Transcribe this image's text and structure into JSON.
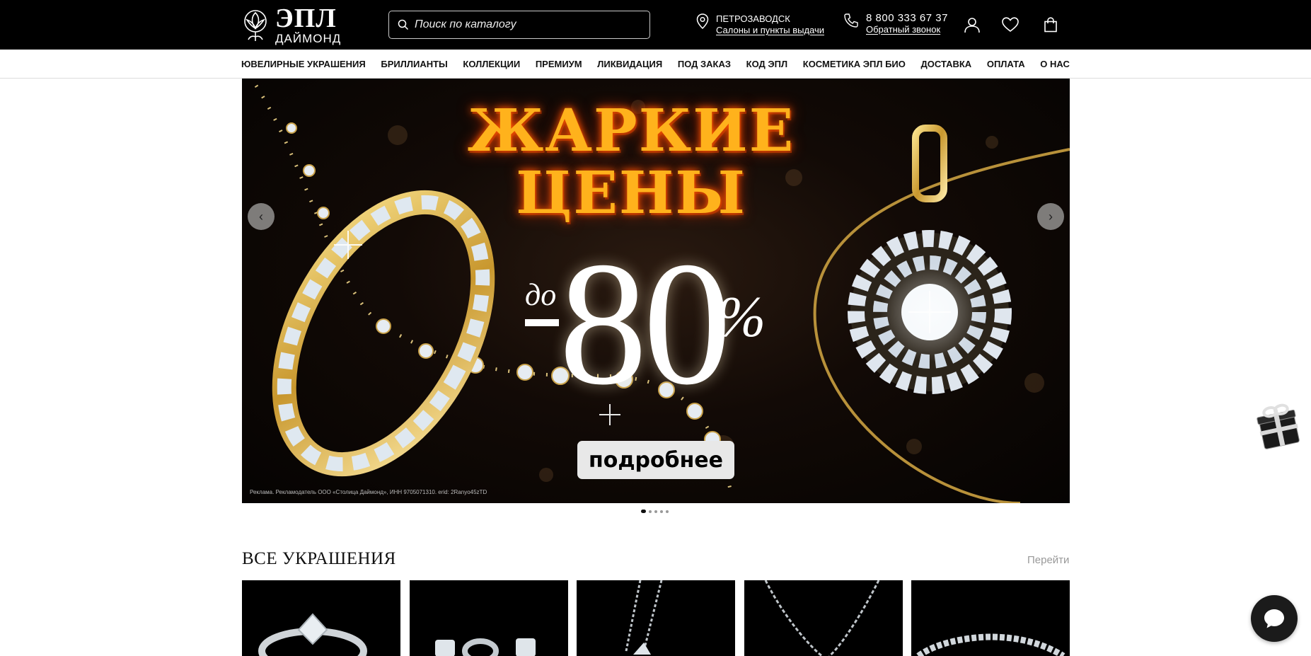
{
  "header": {
    "logo": {
      "main": "ЭПЛ",
      "sub": "ДАЙМОНД"
    },
    "search_placeholder": "Поиск по каталогу",
    "city": {
      "name": "ПЕТРОЗАВОДСК",
      "link": "Салоны и пункты выдачи"
    },
    "phone": {
      "number": "8 800 333 67 37",
      "link": "Обратный звонок"
    },
    "icons": [
      "location-icon",
      "phone-icon",
      "user-icon",
      "heart-icon",
      "bag-icon"
    ]
  },
  "nav": {
    "items": [
      "ЮВЕЛИРНЫЕ УКРАШЕНИЯ",
      "БРИЛЛИАНТЫ",
      "КОЛЛЕКЦИИ",
      "ПРЕМИУМ",
      "ЛИКВИДАЦИЯ",
      "ПОД ЗАКАЗ",
      "КОД ЭПЛ",
      "КОСМЕТИКА ЭПЛ БИО",
      "ДОСТАВКА",
      "ОПЛАТА",
      "О НАС"
    ]
  },
  "banner": {
    "title_line1": "ЖАРКИЕ",
    "title_line2": "ЦЕНЫ",
    "prefix": "до",
    "number": "80",
    "percent": "%",
    "button": "подробнее",
    "ad_note": "Реклама. Рекламодатель ООО «Столица Даймонд», ИНН 9705071310. erid: 2Ranyo45zTD",
    "prev_arrow": "‹",
    "next_arrow": "›",
    "slides_total": 5,
    "active_slide": 1
  },
  "section": {
    "title": "ВСЕ УКРАШЕНИЯ",
    "link": "Перейти",
    "cards": [
      "ring",
      "earrings",
      "pendant",
      "chain",
      "bracelet"
    ]
  },
  "colors": {
    "header_bg": "#000000",
    "accent_fire": "#ffb21c",
    "link_gray": "#999999"
  }
}
